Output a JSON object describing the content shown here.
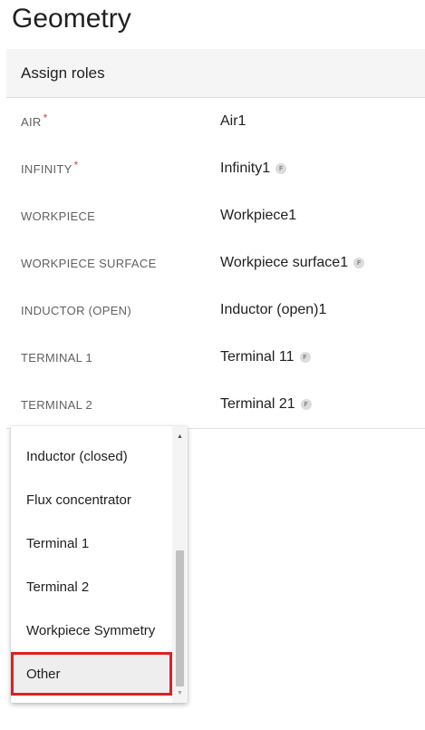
{
  "page": {
    "title": "Geometry"
  },
  "panel": {
    "header": "Assign roles"
  },
  "roles": [
    {
      "label": "AIR",
      "required": "*",
      "value": "Air1",
      "badge": ""
    },
    {
      "label": "INFINITY",
      "required": "*",
      "value": "Infinity1",
      "badge": "F"
    },
    {
      "label": "WORKPIECE",
      "required": "",
      "value": "Workpiece1",
      "badge": ""
    },
    {
      "label": "WORKPIECE SURFACE",
      "required": "",
      "value": "Workpiece surface1",
      "badge": "F"
    },
    {
      "label": "INDUCTOR (OPEN)",
      "required": "",
      "value": "Inductor (open)1",
      "badge": ""
    },
    {
      "label": "TERMINAL 1",
      "required": "",
      "value": "Terminal 11",
      "badge": "F"
    },
    {
      "label": "TERMINAL 2",
      "required": "",
      "value": "Terminal 21",
      "badge": "F"
    }
  ],
  "dropdown": {
    "options": [
      "Inductor (closed)",
      "Flux concentrator",
      "Terminal 1",
      "Terminal 2",
      "Workpiece Symmetry",
      "Other"
    ],
    "selected": "Other",
    "scroll_up": "▲",
    "scroll_down": "▼"
  },
  "colors": {
    "required": "#e53935",
    "highlight": "#e02020"
  }
}
